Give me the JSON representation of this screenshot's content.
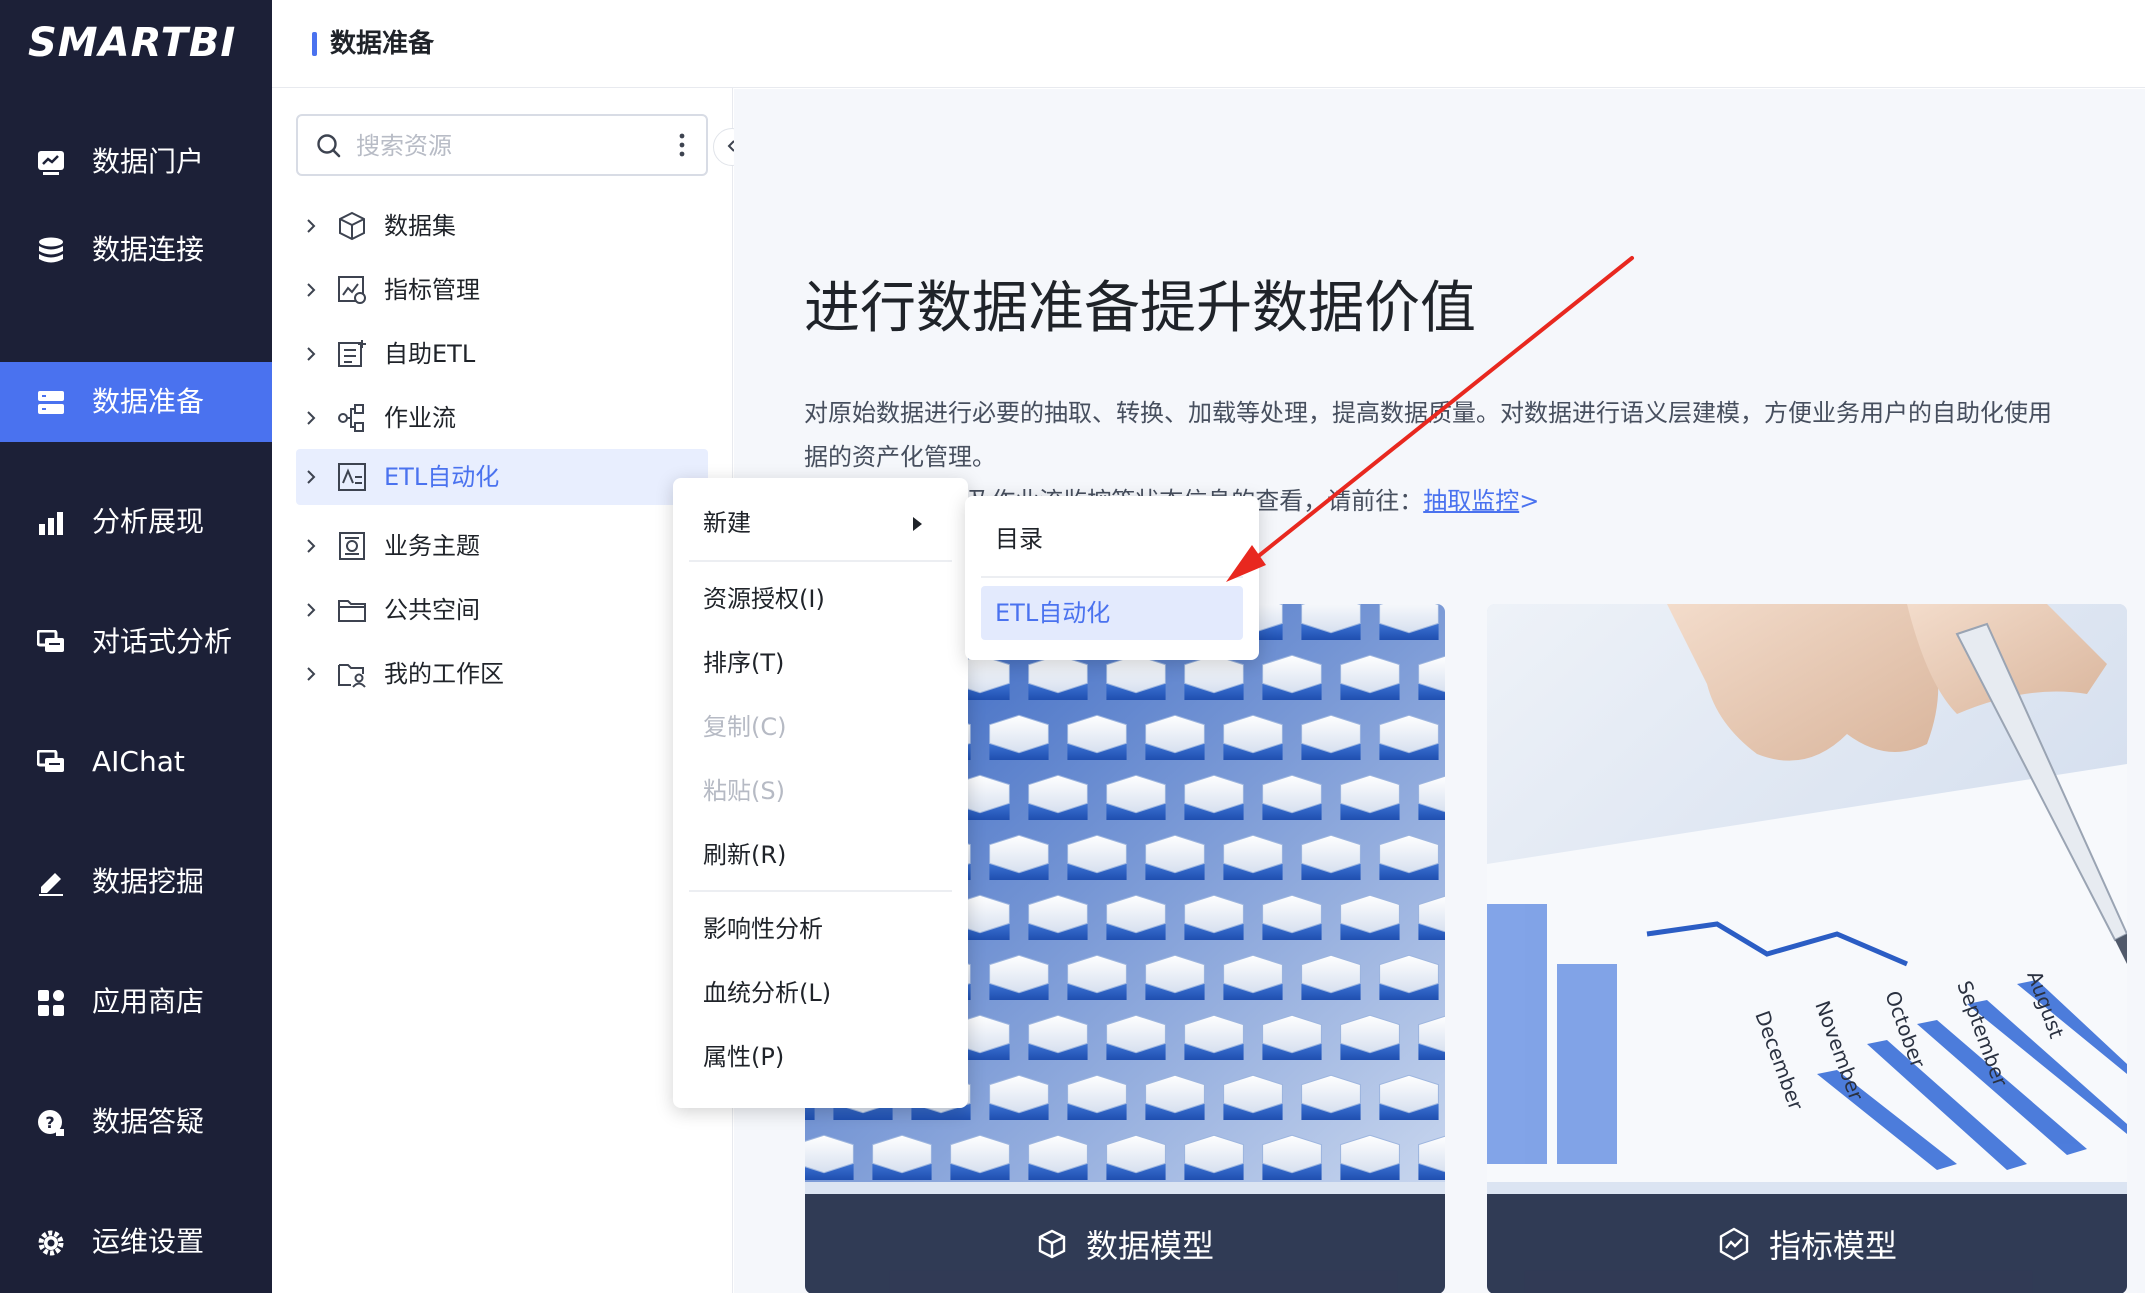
{
  "app": {
    "logo": "SMARTBI"
  },
  "leftnav": {
    "items": [
      {
        "label": "数据门户",
        "icon": "dashboard-icon"
      },
      {
        "label": "数据连接",
        "icon": "database-icon"
      },
      {
        "label": "数据准备",
        "icon": "data-prep-icon",
        "active": true
      },
      {
        "label": "分析展现",
        "icon": "bar-chart-icon"
      },
      {
        "label": "对话式分析",
        "icon": "chat-icon"
      },
      {
        "label": "AIChat",
        "icon": "ai-chat-icon"
      },
      {
        "label": "数据挖掘",
        "icon": "mining-icon"
      },
      {
        "label": "应用商店",
        "icon": "app-store-icon"
      },
      {
        "label": "数据答疑",
        "icon": "question-icon"
      },
      {
        "label": "运维设置",
        "icon": "gear-icon"
      }
    ]
  },
  "header": {
    "title": "数据准备"
  },
  "tree": {
    "search_placeholder": "搜索资源",
    "items": [
      {
        "label": "数据集",
        "icon": "cube-icon"
      },
      {
        "label": "指标管理",
        "icon": "metric-icon"
      },
      {
        "label": "自助ETL",
        "icon": "etl-icon"
      },
      {
        "label": "作业流",
        "icon": "workflow-icon"
      },
      {
        "label": "ETL自动化",
        "icon": "etl-auto-icon",
        "selected": true
      },
      {
        "label": "业务主题",
        "icon": "business-theme-icon"
      },
      {
        "label": "公共空间",
        "icon": "folder-icon"
      },
      {
        "label": "我的工作区",
        "icon": "workspace-icon"
      }
    ]
  },
  "main": {
    "title": "进行数据准备提升数据价值",
    "desc_line1": "对原始数据进行必要的抽取、转换、加载等处理，提高数据质量。对数据进行语义层建模，方便业务用户的自助化使用",
    "desc_line2": "据的资产化管理。",
    "desc_line3_prefix": "…ETL调度、以及作业流监控等状态信息的查看，请前往：",
    "desc_link": "抽取监控",
    "desc_link_suffix": ">",
    "cards": [
      {
        "label": "数据模型",
        "icon": "cube-outline-icon"
      },
      {
        "label": "指标模型",
        "icon": "metric-model-icon"
      }
    ],
    "chart_photo_labels": [
      "December",
      "November",
      "October",
      "September",
      "August"
    ]
  },
  "context_menu": {
    "items": [
      {
        "label": "新建",
        "has_submenu": true
      },
      {
        "label": "资源授权(I)"
      },
      {
        "label": "排序(T)"
      },
      {
        "label": "复制(C)",
        "disabled": true
      },
      {
        "label": "粘贴(S)",
        "disabled": true
      },
      {
        "label": "刷新(R)"
      },
      {
        "label": "影响性分析"
      },
      {
        "label": "血统分析(L)"
      },
      {
        "label": "属性(P)"
      }
    ]
  },
  "sub_menu": {
    "items": [
      {
        "label": "目录"
      },
      {
        "label": "ETL自动化",
        "highlighted": true
      }
    ]
  },
  "colors": {
    "nav_bg": "#1c2037",
    "accent": "#4a72ef",
    "annotation_arrow": "#e8281f"
  }
}
